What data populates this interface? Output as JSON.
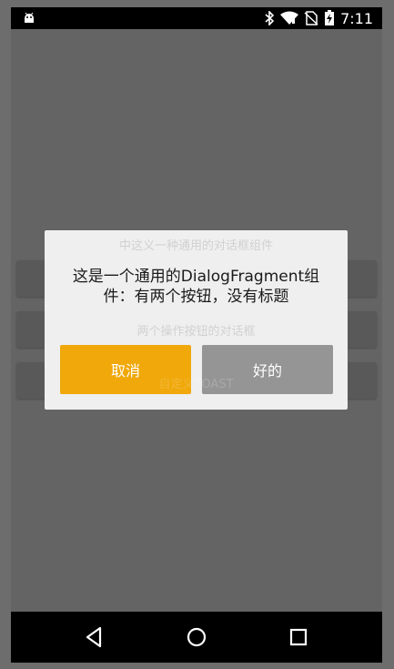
{
  "status_bar": {
    "time": "7:11",
    "icons": [
      "android-debug-icon",
      "bluetooth-icon",
      "wifi-icon",
      "no-sim-icon",
      "battery-charging-icon"
    ]
  },
  "background_buttons": [
    "",
    "",
    ""
  ],
  "dialog": {
    "behind_texts": [
      "中这义一种通用的对话框组件",
      "两个操作按钮的对话框",
      "自定义TOAST"
    ],
    "message": "这是一个通用的DialogFragment组件：有两个按钮，没有标题",
    "cancel_label": "取消",
    "ok_label": "好的",
    "cancel_color": "#f0a80a",
    "ok_color": "#959595"
  },
  "nav_bar": {
    "icons": [
      "back-icon",
      "home-icon",
      "recents-icon"
    ]
  }
}
